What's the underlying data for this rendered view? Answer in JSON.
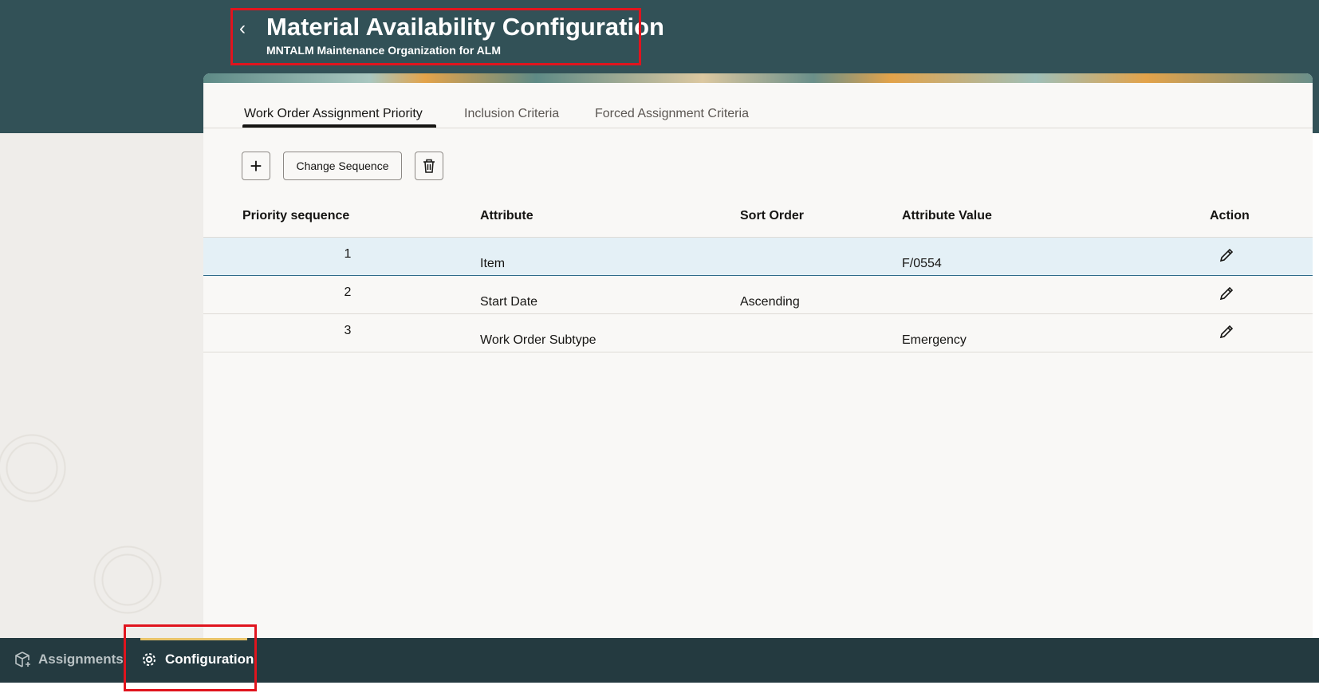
{
  "header": {
    "title": "Material Availability Configuration",
    "subtitle": "MNTALM Maintenance Organization for ALM"
  },
  "tabs": [
    {
      "label": "Work Order Assignment Priority",
      "active": true
    },
    {
      "label": "Inclusion Criteria"
    },
    {
      "label": "Forced Assignment Criteria"
    }
  ],
  "toolbar": {
    "add": "+",
    "change_sequence": "Change Sequence"
  },
  "table": {
    "columns": [
      "Priority sequence",
      "Attribute",
      "Sort Order",
      "Attribute Value",
      "Action"
    ],
    "rows": [
      {
        "seq": "1",
        "attribute": "Item",
        "sort": "",
        "value": "F/0554"
      },
      {
        "seq": "2",
        "attribute": "Start Date",
        "sort": "Ascending",
        "value": ""
      },
      {
        "seq": "3",
        "attribute": "Work Order Subtype",
        "sort": "",
        "value": "Emergency"
      }
    ]
  },
  "bottom_nav": [
    {
      "label": "Assignments"
    },
    {
      "label": "Configuration",
      "active": true
    }
  ],
  "colors": {
    "header": "#325157",
    "nav": "#243a40",
    "accent": "#e9c46a",
    "highlight": "#e0141e"
  }
}
